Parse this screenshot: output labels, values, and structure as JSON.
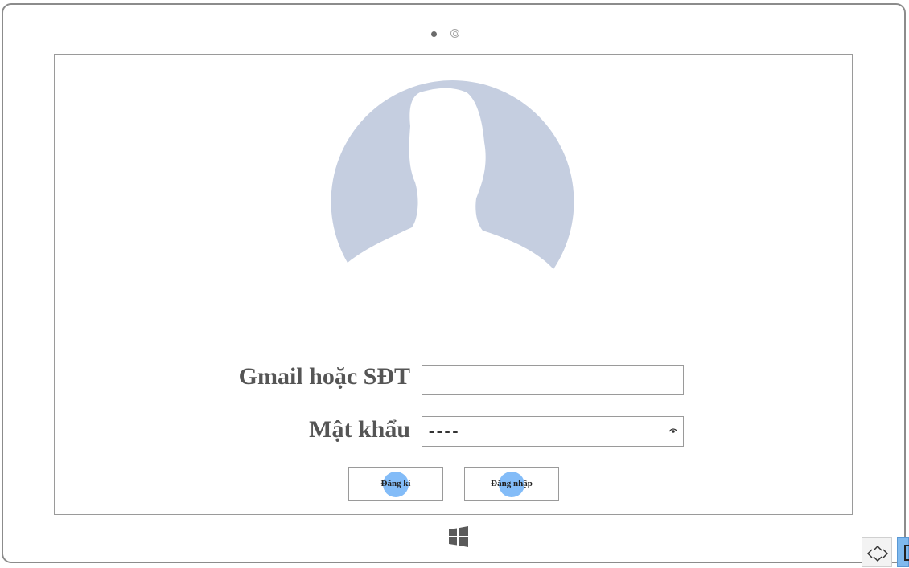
{
  "form": {
    "email_label": "Gmail hoặc SĐT",
    "email_value": "",
    "password_label": "Mật khẩu",
    "password_mask": "----"
  },
  "buttons": {
    "register_label": "Đăng kí",
    "login_label": "Đăng nhập"
  },
  "icons": {
    "avatar": "default-user-silhouette",
    "eye": "show-password-icon",
    "windows": "windows-logo-icon",
    "expand": "expand-arrows-icon",
    "panel": "side-panel-icon"
  },
  "colors": {
    "avatar_fill": "#c5cee0",
    "click_indicator": "#5aa5f5",
    "label_text": "#555555",
    "frame": "#8c8c8c"
  }
}
